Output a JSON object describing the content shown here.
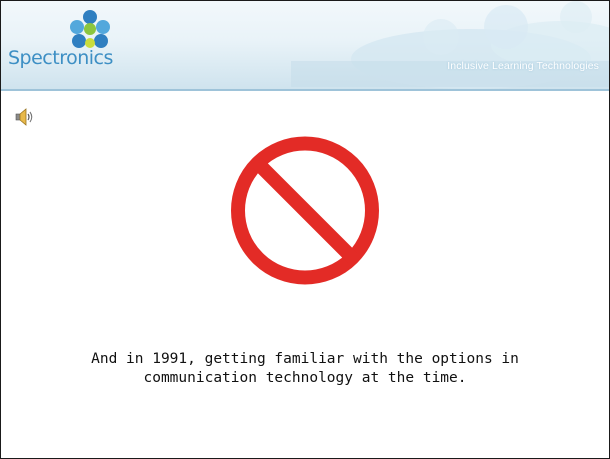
{
  "header": {
    "logo_text": "Spectronics",
    "tagline": "Inclusive Learning Technologies"
  },
  "icons": {
    "speaker": "speaker-icon",
    "prohibition": "prohibition-sign"
  },
  "colors": {
    "prohibition_red": "#e32b26",
    "logo_blue": "#3d8fc4"
  },
  "caption": {
    "line1": "And in 1991, getting familiar with the options in",
    "line2": "communication technology at the time."
  }
}
